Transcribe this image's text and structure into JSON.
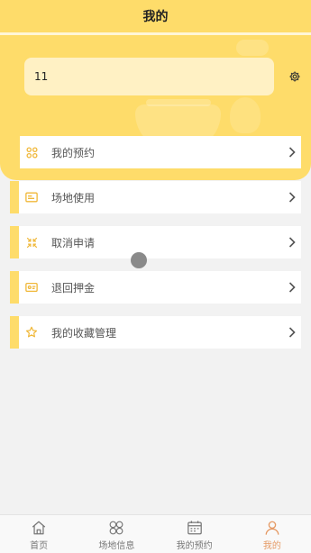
{
  "header": {
    "title": "我的"
  },
  "user": {
    "name": "11",
    "settings_icon": "gear-icon"
  },
  "colors": {
    "accent": "#fedc6a",
    "active_tab": "#e59a65",
    "icon": "#f0b83a"
  },
  "menu": [
    {
      "label": "我的预约",
      "icon": "grid-circles-icon"
    },
    {
      "label": "场地使用",
      "icon": "card-icon"
    },
    {
      "label": "取消申请",
      "icon": "shrink-arrows-icon"
    },
    {
      "label": "退回押金",
      "icon": "wallet-icon"
    },
    {
      "label": "我的收藏管理",
      "icon": "star-icon"
    }
  ],
  "tabbar": [
    {
      "label": "首页",
      "icon": "home-icon",
      "active": false
    },
    {
      "label": "场地信息",
      "icon": "venue-circles-icon",
      "active": false
    },
    {
      "label": "我的预约",
      "icon": "calendar-icon",
      "active": false
    },
    {
      "label": "我的",
      "icon": "person-icon",
      "active": true
    }
  ]
}
